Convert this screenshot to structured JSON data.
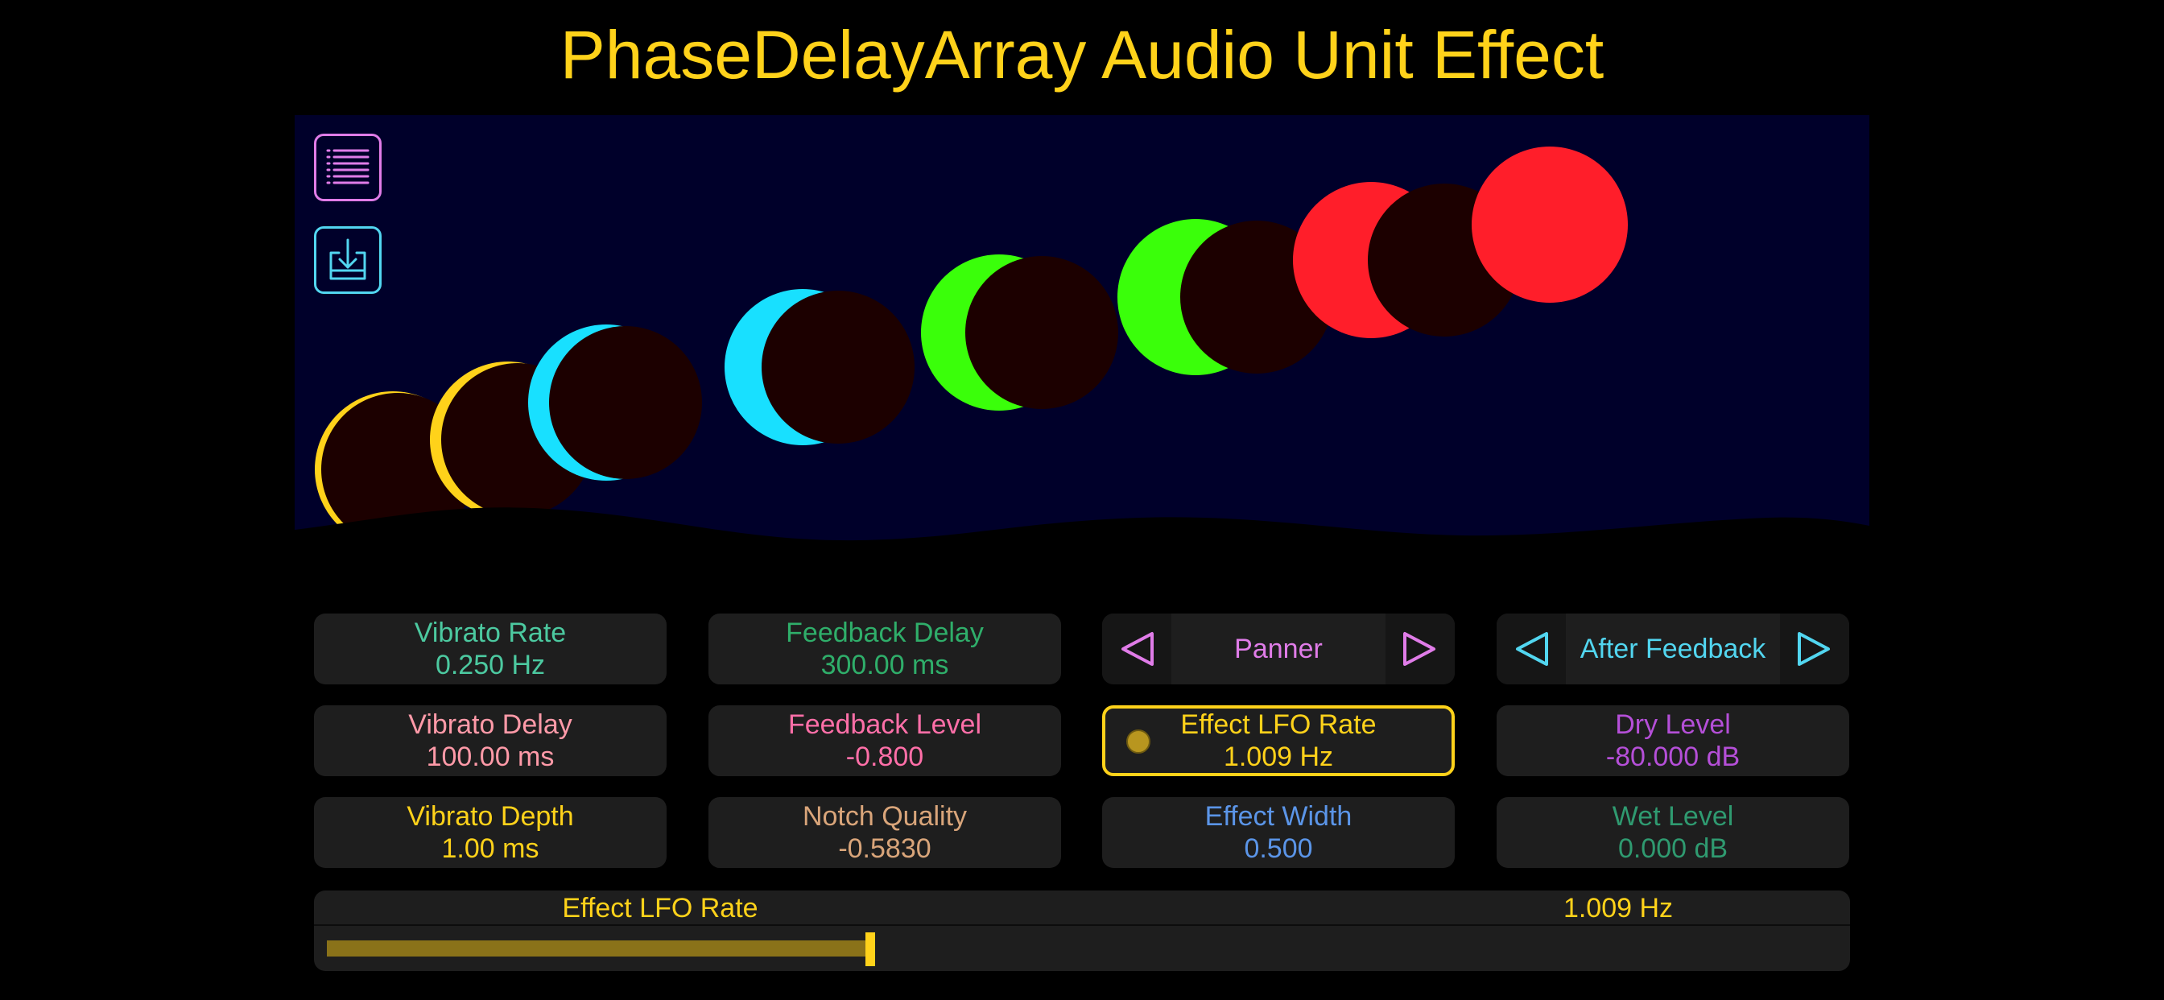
{
  "title": "PhaseDelayArray Audio Unit Effect",
  "colors": {
    "background": "#000000",
    "viz_background": "#00002a",
    "title": "#ffd21a",
    "moon_dark": "#1c0000",
    "moon_yellow": "#ffd21a",
    "moon_cyan": "#18e0ff",
    "moon_green": "#3aff0a",
    "moon_red": "#ff1e2a"
  },
  "toolbar": {
    "presets_icon": "list-icon",
    "save_icon": "save-icon"
  },
  "moons": [
    {
      "color": "#ffd21a",
      "phase": 0.06
    },
    {
      "color": "#ffd21a",
      "phase": 0.12
    },
    {
      "color": "#18e0ff",
      "phase": 0.25
    },
    {
      "color": "#18e0ff",
      "phase": 0.45
    },
    {
      "color": "#3aff0a",
      "phase": 0.55
    },
    {
      "color": "#3aff0a",
      "phase": 0.78
    },
    {
      "color": "#ff1e2a",
      "phase": 0.94
    },
    {
      "color": "#ff1e2a",
      "phase": 1.0
    }
  ],
  "params": {
    "vibrato_rate": {
      "label": "Vibrato Rate",
      "value": "0.250 Hz",
      "color": "#4cc9a0"
    },
    "vibrato_delay": {
      "label": "Vibrato Delay",
      "value": "100.00 ms",
      "color": "#ff9aa8"
    },
    "vibrato_depth": {
      "label": "Vibrato Depth",
      "value": "1.00 ms",
      "color": "#ffd21a"
    },
    "feedback_delay": {
      "label": "Feedback Delay",
      "value": "300.00 ms",
      "color": "#2fae6a"
    },
    "feedback_level": {
      "label": "Feedback Level",
      "value": "-0.800",
      "color": "#ff6fa8"
    },
    "notch_quality": {
      "label": "Notch Quality",
      "value": "-0.5830",
      "color": "#d9a57a"
    },
    "effect_lfo_rate": {
      "label": "Effect LFO Rate",
      "value": "1.009 Hz",
      "color": "#ffd21a"
    },
    "effect_width": {
      "label": "Effect Width",
      "value": "0.500",
      "color": "#5b95e8"
    },
    "dry_level": {
      "label": "Dry Level",
      "value": "-80.000 dB",
      "color": "#b54fd8"
    },
    "wet_level": {
      "label": "Wet Level",
      "value": "0.000 dB",
      "color": "#2f9a70"
    }
  },
  "selectors": {
    "mode": {
      "value": "Panner",
      "color": "#e07ce8"
    },
    "position": {
      "value": "After Feedback",
      "color": "#52d6f0"
    }
  },
  "slider": {
    "label": "Effect LFO Rate",
    "value": "1.009 Hz",
    "fraction": 0.36
  }
}
